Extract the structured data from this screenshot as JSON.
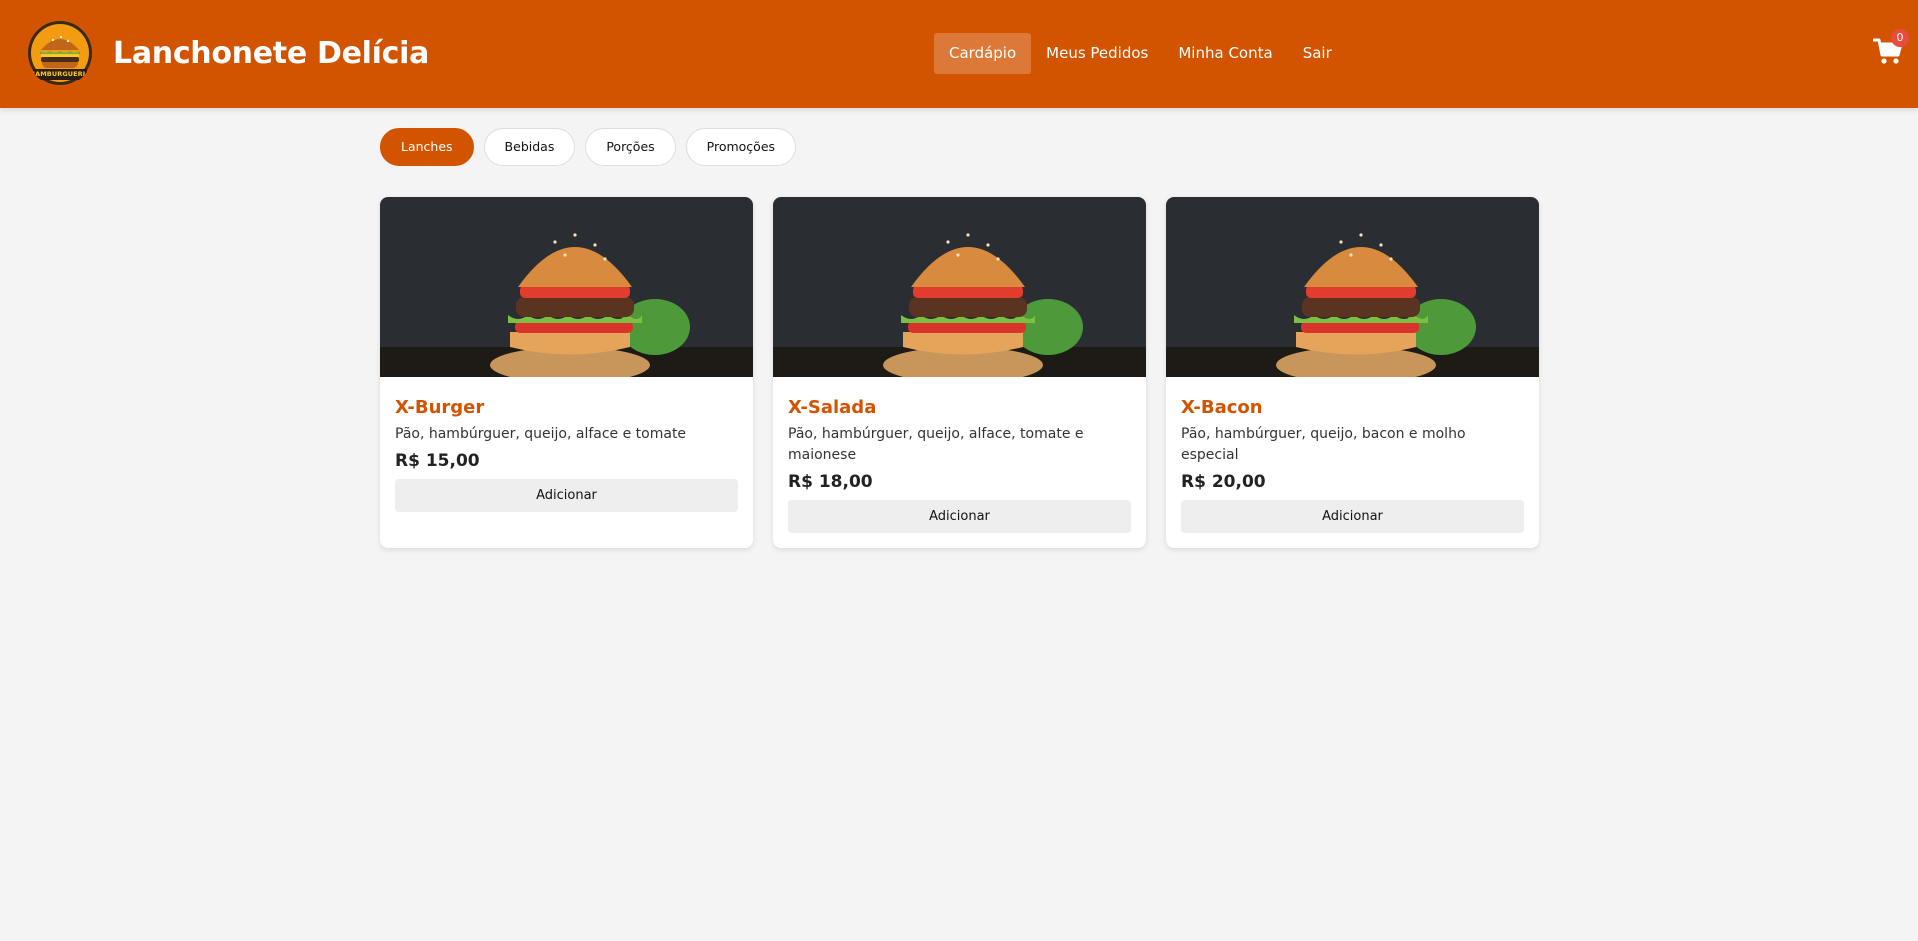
{
  "header": {
    "logo_icon": "burger-logo-icon",
    "logo_text": "HAMBURGUERIA",
    "title": "Lanchonete Delícia",
    "brand_color": "#d35400",
    "nav": [
      {
        "label": "Cardápio",
        "active": true
      },
      {
        "label": "Meus Pedidos",
        "active": false
      },
      {
        "label": "Minha Conta",
        "active": false
      },
      {
        "label": "Sair",
        "active": false
      }
    ],
    "cart": {
      "icon": "cart-icon",
      "count": "0",
      "badge_color": "#e74c3c"
    }
  },
  "categories": [
    {
      "label": "Lanches",
      "active": true
    },
    {
      "label": "Bebidas",
      "active": false
    },
    {
      "label": "Porções",
      "active": false
    },
    {
      "label": "Promoções",
      "active": false
    }
  ],
  "products": [
    {
      "name": "X-Burger",
      "description": "Pão, hambúrguer, queijo, alface e tomate",
      "price": "R$ 15,00",
      "button_label": "Adicionar"
    },
    {
      "name": "X-Salada",
      "description": "Pão, hambúrguer, queijo, alface, tomate e maionese",
      "price": "R$ 18,00",
      "button_label": "Adicionar"
    },
    {
      "name": "X-Bacon",
      "description": "Pão, hambúrguer, queijo, bacon e molho especial",
      "price": "R$ 20,00",
      "button_label": "Adicionar"
    }
  ]
}
